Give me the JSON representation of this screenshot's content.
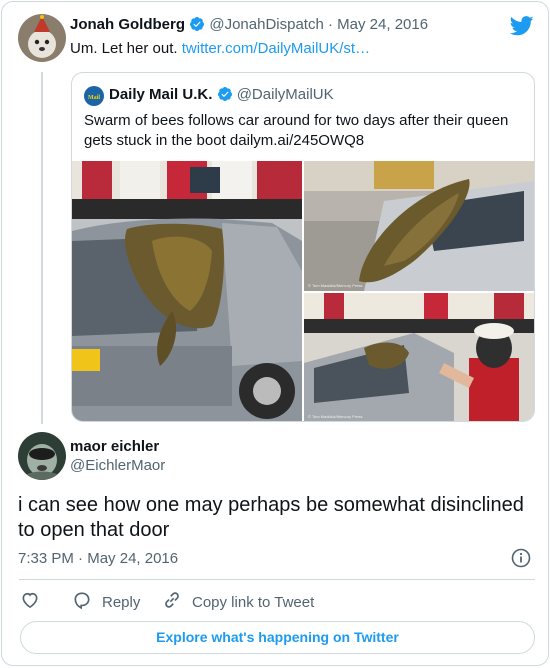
{
  "tweet": {
    "author_name": "Jonah Goldberg",
    "author_handle": "@JonahDispatch",
    "separator": "·",
    "date": "May 24, 2016",
    "text": "Um. Let her out.",
    "link_text": "twitter.com/DailyMailUK/st…"
  },
  "quote": {
    "author_name": "Daily Mail U.K.",
    "author_handle": "@DailyMailUK",
    "avatar_text": "Mail",
    "text_line1": "Swarm of bees follows car around for two days after their queen",
    "text_line2": "gets stuck in the boot dailym.ai/245OWQ8",
    "photo_credit": "© Tom Maddick/Mercury Press"
  },
  "reply": {
    "author_name": "maor eichler",
    "author_handle": "@EichlerMaor",
    "text_line1": "i can see how one may perhaps be somewhat disinclined",
    "text_line2": "to open that door",
    "time": "7:33 PM",
    "separator": "·",
    "date": "May 24, 2016"
  },
  "actions": {
    "reply_label": "Reply",
    "copy_label": "Copy link to Tweet",
    "explore_label": "Explore what's happening on Twitter"
  },
  "colors": {
    "accent": "#1d9bf0",
    "muted": "#536471",
    "border": "#cfd9de"
  },
  "icons": [
    "twitter-bird-icon",
    "verified-badge-icon",
    "info-icon",
    "heart-icon",
    "reply-icon",
    "link-icon"
  ]
}
